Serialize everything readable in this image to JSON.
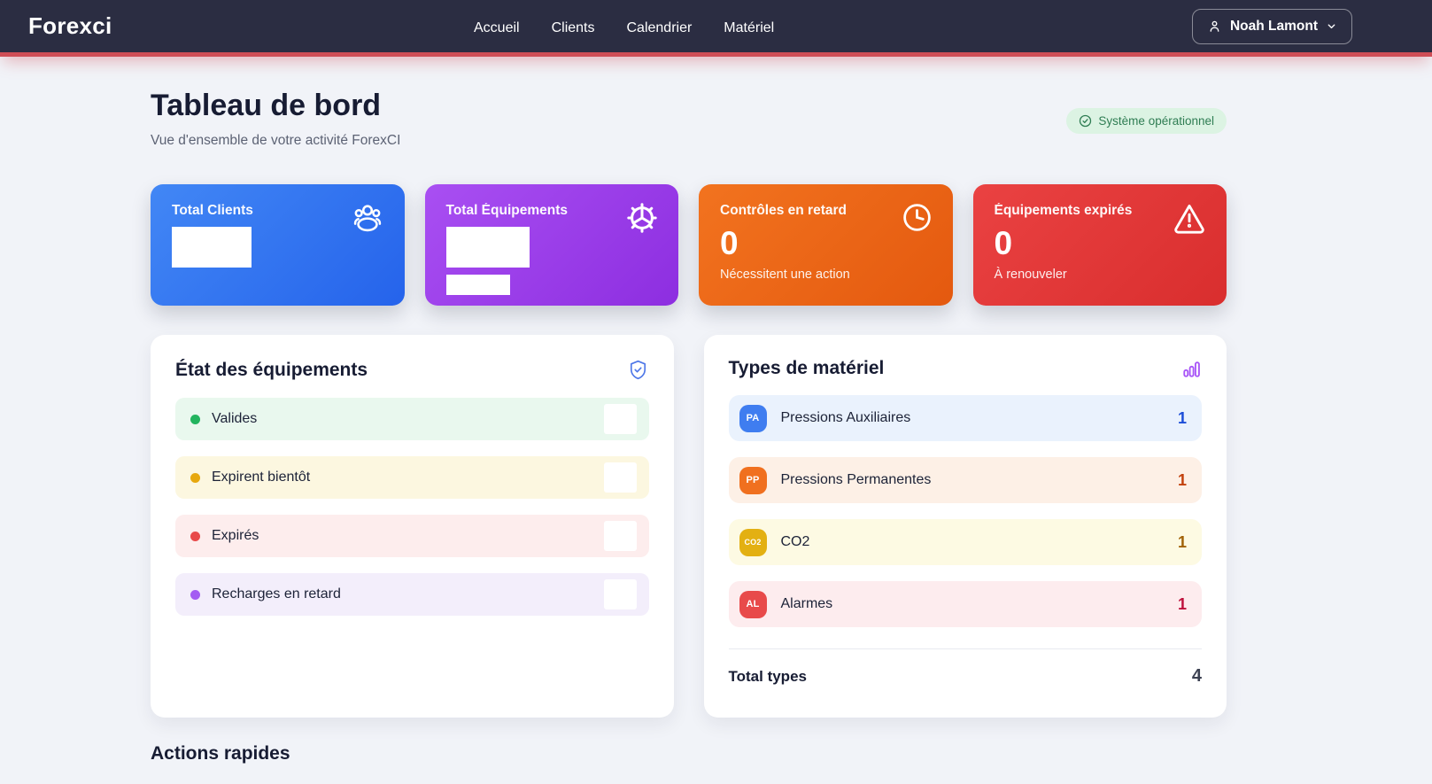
{
  "navbar": {
    "brand": "Forexci",
    "links": [
      {
        "label": "Accueil"
      },
      {
        "label": "Clients"
      },
      {
        "label": "Calendrier"
      },
      {
        "label": "Matériel"
      }
    ],
    "user": {
      "name": "Noah Lamont"
    },
    "accent_line_color": "#cf4e56",
    "bg_color": "#2b2d42"
  },
  "header": {
    "title": "Tableau de bord",
    "subtitle": "Vue d'ensemble de votre activité ForexCI",
    "status_badge": {
      "label": "Système opérationnel",
      "icon": "check-circle-icon",
      "bg": "#dcf3e3",
      "text_color": "#2f7d53"
    }
  },
  "stat_cards": [
    {
      "label": "Total Clients",
      "icon": "users-icon",
      "value": "",
      "subtitle": "",
      "value_redacted": true,
      "subtitle_redacted": false,
      "gradient": [
        "#4287f5",
        "#2563eb"
      ]
    },
    {
      "label": "Total Équipements",
      "icon": "gear-icon",
      "value": "",
      "subtitle": "",
      "value_redacted": true,
      "subtitle_redacted": true,
      "gradient": [
        "#a94ff2",
        "#8d2ee0"
      ]
    },
    {
      "label": "Contrôles en retard",
      "icon": "clock-icon",
      "value": "0",
      "subtitle": "Nécessitent une action",
      "value_redacted": false,
      "subtitle_redacted": false,
      "gradient": [
        "#f2731f",
        "#e4590f"
      ]
    },
    {
      "label": "Équipements expirés",
      "icon": "alert-triangle-icon",
      "value": "0",
      "subtitle": "À renouveler",
      "value_redacted": false,
      "subtitle_redacted": false,
      "gradient": [
        "#ea4242",
        "#d92e2e"
      ]
    }
  ],
  "equipment_status": {
    "title": "État des équipements",
    "icon": "shield-check-icon",
    "rows": [
      {
        "label": "Valides",
        "dot_color": "#22b45e",
        "row_bg": "#e9f8ee",
        "value_redacted": true
      },
      {
        "label": "Expirent bientôt",
        "dot_color": "#e7a80e",
        "row_bg": "#fcf7e0",
        "value_redacted": true
      },
      {
        "label": "Expirés",
        "dot_color": "#e84a4a",
        "row_bg": "#fdeded",
        "value_redacted": true
      },
      {
        "label": "Recharges en retard",
        "dot_color": "#a45df2",
        "row_bg": "#f3eefb",
        "value_redacted": true
      }
    ]
  },
  "material_types": {
    "title": "Types de matériel",
    "icon": "bar-chart-icon",
    "rows": [
      {
        "badge": "PA",
        "badge_bg": "#3f7df0",
        "label": "Pressions Auxiliaires",
        "count": "1",
        "count_color": "#1d4ed8",
        "row_bg": "#eaf2fd"
      },
      {
        "badge": "PP",
        "badge_bg": "#f0701f",
        "label": "Pressions Permanentes",
        "count": "1",
        "count_color": "#c2410c",
        "row_bg": "#fdf0e6"
      },
      {
        "badge": "CO2",
        "badge_bg": "#e3b012",
        "label": "CO2",
        "count": "1",
        "count_color": "#a16207",
        "row_bg": "#fdfae3"
      },
      {
        "badge": "AL",
        "badge_bg": "#e84a4a",
        "label": "Alarmes",
        "count": "1",
        "count_color": "#be123c",
        "row_bg": "#fdecee"
      }
    ],
    "footer": {
      "label": "Total types",
      "value": "4"
    }
  },
  "quick_actions": {
    "title": "Actions rapides"
  }
}
